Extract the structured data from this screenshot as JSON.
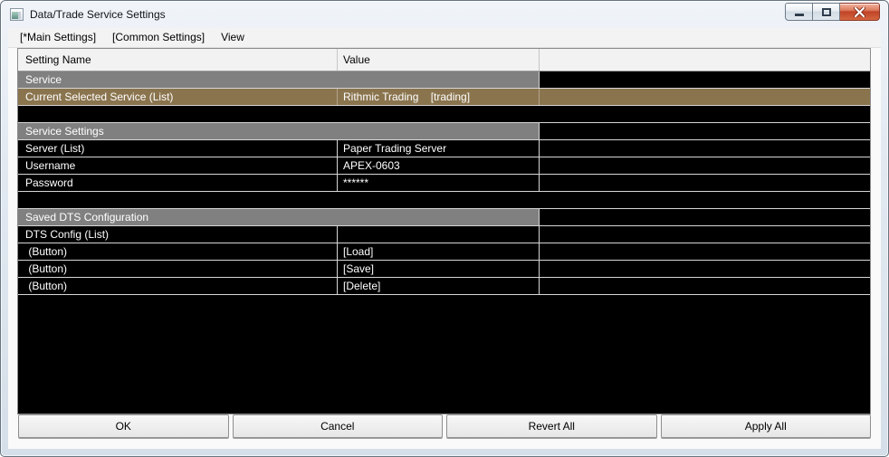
{
  "window": {
    "title": "Data/Trade Service Settings",
    "icons": {
      "window_icon": "app-window",
      "minimize": "minimize-bar",
      "maximize": "restore-square",
      "close": "close-x"
    }
  },
  "menu": {
    "items": [
      {
        "key": "main-settings",
        "label": "[*Main Settings]"
      },
      {
        "key": "common-settings",
        "label": "[Common Settings]"
      },
      {
        "key": "view",
        "label": "View"
      }
    ]
  },
  "table": {
    "headers": [
      "Setting Name",
      "Value",
      ""
    ],
    "rows": [
      {
        "type": "section",
        "key": "service",
        "name": "Service"
      },
      {
        "type": "selected",
        "key": "current-selected-service",
        "name": "Current Selected Service (List)",
        "value": "Rithmic Trading    [trading]"
      },
      {
        "type": "spacer",
        "key": "spacer-1"
      },
      {
        "type": "section",
        "key": "service-settings",
        "name": "Service Settings"
      },
      {
        "type": "data",
        "key": "server",
        "name": "Server (List)",
        "value": "Paper Trading Server"
      },
      {
        "type": "data",
        "key": "username",
        "name": "Username",
        "value": "APEX-0603"
      },
      {
        "type": "data",
        "key": "password",
        "name": "Password",
        "value": "******"
      },
      {
        "type": "spacer",
        "key": "spacer-2"
      },
      {
        "type": "section",
        "key": "saved-dts-configuration",
        "name": "Saved DTS Configuration"
      },
      {
        "type": "data",
        "key": "dts-config",
        "name": "DTS Config (List)",
        "value": ""
      },
      {
        "type": "data",
        "key": "load-button",
        "name": " (Button)",
        "value": "[Load]"
      },
      {
        "type": "data",
        "key": "save-button",
        "name": " (Button)",
        "value": "[Save]"
      },
      {
        "type": "data",
        "key": "delete-button",
        "name": " (Button)",
        "value": "[Delete]"
      }
    ]
  },
  "buttons": [
    {
      "key": "ok",
      "label": "OK"
    },
    {
      "key": "cancel",
      "label": "Cancel"
    },
    {
      "key": "revert-all",
      "label": "Revert All"
    },
    {
      "key": "apply-all",
      "label": "Apply All"
    }
  ],
  "colors": {
    "selected_bg": "#8A744E",
    "section_bg": "#808080",
    "row_bg": "#000000",
    "row_text": "#FFFFFF",
    "header_bg": "#F2F2F2",
    "close_red": "#C14328"
  }
}
